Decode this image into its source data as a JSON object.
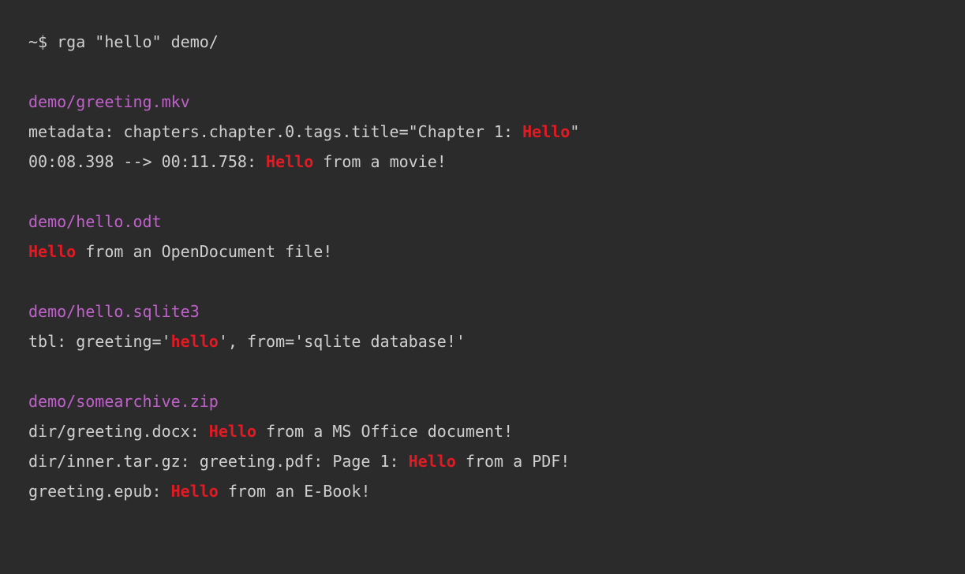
{
  "command": {
    "prompt": "~$ ",
    "text": "rga \"hello\" demo/"
  },
  "results": [
    {
      "file": "demo/greeting.mkv",
      "lines": [
        {
          "pre": "metadata: chapters.chapter.0.tags.title=\"Chapter 1: ",
          "match": "Hello",
          "post": "\""
        },
        {
          "pre": "00:08.398 --> 00:11.758: ",
          "match": "Hello",
          "post": " from a movie!"
        }
      ]
    },
    {
      "file": "demo/hello.odt",
      "lines": [
        {
          "pre": "",
          "match": "Hello",
          "post": " from an OpenDocument file!"
        }
      ]
    },
    {
      "file": "demo/hello.sqlite3",
      "lines": [
        {
          "pre": "tbl: greeting='",
          "match": "hello",
          "post": "', from='sqlite database!'"
        }
      ]
    },
    {
      "file": "demo/somearchive.zip",
      "lines": [
        {
          "pre": "dir/greeting.docx: ",
          "match": "Hello",
          "post": " from a MS Office document!"
        },
        {
          "pre": "dir/inner.tar.gz: greeting.pdf: Page 1: ",
          "match": "Hello",
          "post": " from a PDF!"
        },
        {
          "pre": "greeting.epub: ",
          "match": "Hello",
          "post": " from an E-Book!"
        }
      ]
    }
  ]
}
